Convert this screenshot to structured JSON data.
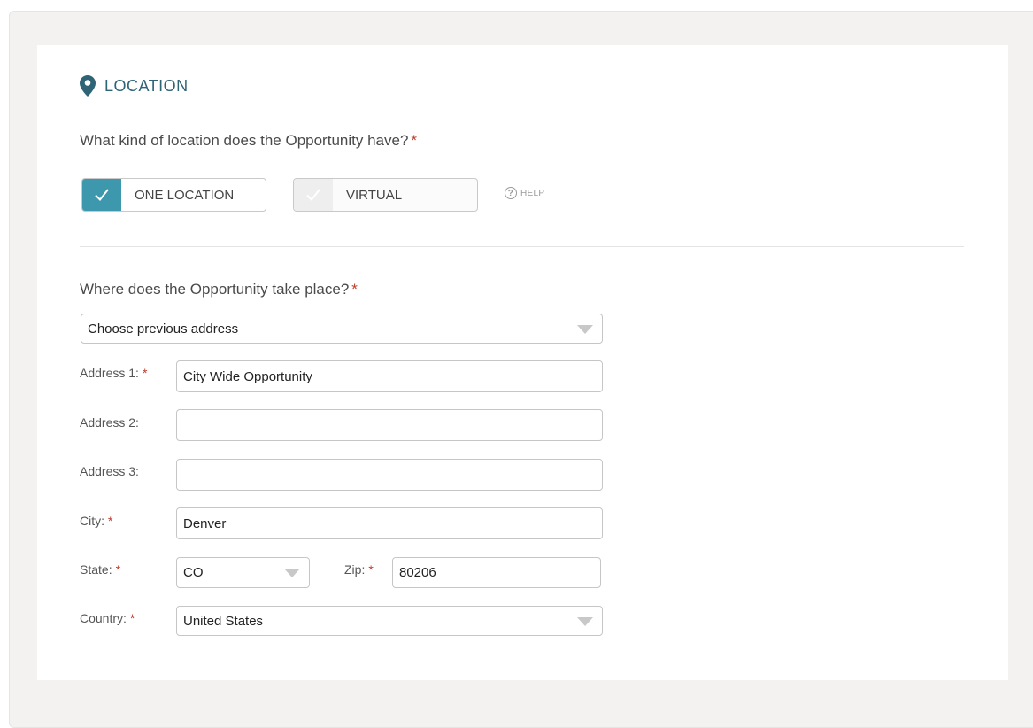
{
  "section": {
    "title": "LOCATION",
    "icon": "map-pin-icon",
    "accent_color": "#2f6477"
  },
  "location_type": {
    "question": "What kind of location does the Opportunity have?",
    "required_mark": "*",
    "options": [
      {
        "label": "ONE LOCATION",
        "selected": true
      },
      {
        "label": "VIRTUAL",
        "selected": false
      }
    ],
    "help_label": "HELP"
  },
  "address": {
    "question": "Where does the Opportunity take place?",
    "required_mark": "*",
    "previous_address_select": "Choose previous address",
    "fields": {
      "address1": {
        "label": "Address 1:",
        "required": "*",
        "value": "City Wide Opportunity"
      },
      "address2": {
        "label": "Address 2:",
        "value": ""
      },
      "address3": {
        "label": "Address 3:",
        "value": ""
      },
      "city": {
        "label": "City:",
        "required": "*",
        "value": "Denver"
      },
      "state": {
        "label": "State:",
        "required": "*",
        "value": "CO"
      },
      "zip": {
        "label": "Zip:",
        "required": "*",
        "value": "80206"
      },
      "country": {
        "label": "Country:",
        "required": "*",
        "value": "United States"
      }
    }
  }
}
